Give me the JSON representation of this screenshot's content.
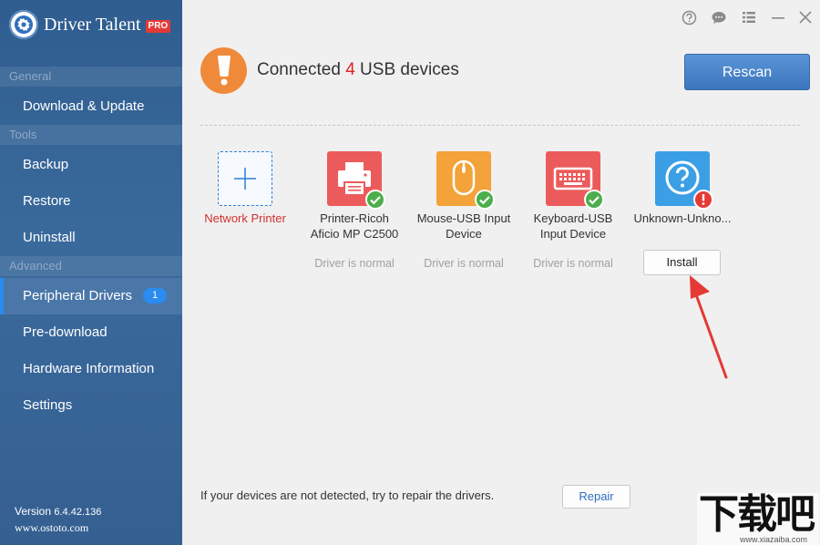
{
  "app": {
    "title": "Driver Talent",
    "badge": "PRO"
  },
  "sidebar": {
    "sections": [
      {
        "header": "General",
        "items": [
          {
            "label": "Download & Update"
          }
        ]
      },
      {
        "header": "Tools",
        "items": [
          {
            "label": "Backup"
          },
          {
            "label": "Restore"
          },
          {
            "label": "Uninstall"
          }
        ]
      },
      {
        "header": "Advanced",
        "items": [
          {
            "label": "Peripheral Drivers",
            "badge": "1",
            "active": true
          },
          {
            "label": "Pre-download"
          },
          {
            "label": "Hardware Information"
          },
          {
            "label": "Settings"
          }
        ]
      }
    ],
    "version_label": "Version",
    "version_number": "6.4.42.136",
    "website": "www.ostoto.com"
  },
  "window_controls": [
    "help-icon",
    "feedback-icon",
    "menu-icon",
    "minimize-icon",
    "close-icon"
  ],
  "header": {
    "prefix": "Connected",
    "count": "4",
    "suffix": "USB devices",
    "rescan_label": "Rescan"
  },
  "devices": [
    {
      "name": "Network Printer",
      "icon": "add-icon",
      "status": ""
    },
    {
      "name_line1": "Printer-Ricoh",
      "name_line2": "Aficio MP C2500",
      "icon": "printer-icon",
      "status": "Driver is normal",
      "color": "#ec5b5b"
    },
    {
      "name_line1": "Mouse-USB Input",
      "name_line2": "Device",
      "icon": "mouse-icon",
      "status": "Driver is normal",
      "color": "#f4a23a"
    },
    {
      "name_line1": "Keyboard-USB",
      "name_line2": "Input Device",
      "icon": "keyboard-icon",
      "status": "Driver is normal",
      "color": "#ec5b5b"
    },
    {
      "name": "Unknown-Unkno...",
      "icon": "unknown-device-icon",
      "action": "Install",
      "color": "#3b9fe6"
    }
  ],
  "footer": {
    "hint": "If your devices are not detected, try to repair the drivers.",
    "repair_label": "Repair"
  },
  "watermark": {
    "logo": "下载吧",
    "site": "www.xiazaiba.com"
  }
}
